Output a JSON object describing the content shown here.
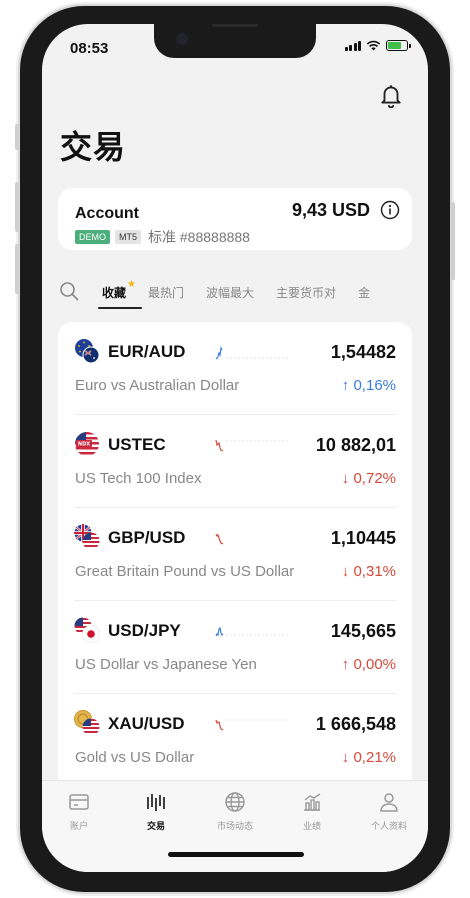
{
  "status": {
    "time": "08:53"
  },
  "header": {
    "title": "交易"
  },
  "account": {
    "name": "Account",
    "tag_demo": "DEMO",
    "tag_platform": "MT5",
    "type_number": "标准 #88888888",
    "balance": "9,43 USD"
  },
  "tabs": [
    {
      "label": "收藏",
      "active": true
    },
    {
      "label": "最热门"
    },
    {
      "label": "波幅最大"
    },
    {
      "label": "主要货币对"
    },
    {
      "label": "金"
    }
  ],
  "instruments": [
    {
      "symbol": "EUR/AUD",
      "description": "Euro vs Australian Dollar",
      "price": "1,54482",
      "change": "↑ 0,16%",
      "trend": "up"
    },
    {
      "symbol": "USTEC",
      "description": "US Tech 100 Index",
      "price": "10 882,01",
      "change": "↓ 0,72%",
      "trend": "down"
    },
    {
      "symbol": "GBP/USD",
      "description": "Great Britain Pound vs US Dollar",
      "price": "1,10445",
      "change": "↓ 0,31%",
      "trend": "down"
    },
    {
      "symbol": "USD/JPY",
      "description": "US Dollar vs Japanese Yen",
      "price": "145,665",
      "change": "↑ 0,00%",
      "trend": "flat"
    },
    {
      "symbol": "XAU/USD",
      "description": "Gold vs US Dollar",
      "price": "1 666,548",
      "change": "↓ 0,21%",
      "trend": "down"
    }
  ],
  "nav": [
    {
      "label": "账户",
      "icon": "card-icon"
    },
    {
      "label": "交易",
      "icon": "candles-icon",
      "active": true
    },
    {
      "label": "市场动态",
      "icon": "globe-icon"
    },
    {
      "label": "业绩",
      "icon": "chart-icon"
    },
    {
      "label": "个人资料",
      "icon": "person-icon"
    }
  ],
  "colors": {
    "up": "#3b7ddd",
    "down": "#d34a3a",
    "demo": "#4cae7a",
    "star": "#f2b614"
  }
}
